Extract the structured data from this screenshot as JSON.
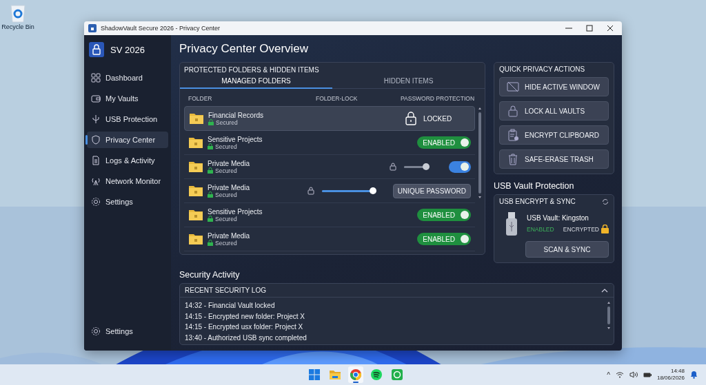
{
  "desktop": {
    "icons": [
      {
        "label": "Recycle Bin"
      }
    ]
  },
  "window": {
    "title": "ShadowVault Secure 2026 - Privacy Center"
  },
  "sidebar": {
    "brand": "SV 2026",
    "items": [
      {
        "label": "Dashboard",
        "selected": false
      },
      {
        "label": "My Vaults",
        "selected": false
      },
      {
        "label": "USB Protection",
        "selected": false
      },
      {
        "label": "Privacy Center",
        "selected": true
      },
      {
        "label": "Logs & Activity",
        "selected": false
      },
      {
        "label": "Network Monitor",
        "selected": false
      },
      {
        "label": "Settings",
        "selected": false
      }
    ],
    "footer_item": {
      "label": "Settings"
    }
  },
  "page_title": "Privacy Center Overview",
  "folders_panel": {
    "title": "PROTECTED FOLDERS & HIDDEN ITEMS",
    "tabs": [
      {
        "label": "MANAGED FOLDERS",
        "selected": true
      },
      {
        "label": "HIDDEN ITEMS",
        "selected": false
      }
    ],
    "columns": [
      "FOLDER",
      "FOLDER-LOCK",
      "PASSWORD PROTECTION"
    ],
    "rows": [
      {
        "name": "Financial Records",
        "status": "Secured",
        "selected": true,
        "protection": {
          "kind": "locked",
          "label": "LOCKED"
        }
      },
      {
        "name": "Sensitive Projects",
        "status": "Secured",
        "selected": false,
        "protection": {
          "kind": "labeled_toggle",
          "label": "ENABLED",
          "on": true
        }
      },
      {
        "name": "Private Media",
        "status": "Secured",
        "selected": false,
        "folder_lock": {
          "level": 0.9,
          "enabled": false
        },
        "protection": {
          "kind": "toggle",
          "on": true
        }
      },
      {
        "name": "Private Media",
        "status": "Secured",
        "selected": false,
        "folder_lock": {
          "level": 1,
          "enabled": true
        },
        "protection": {
          "kind": "button",
          "label": "UNIQUE PASSWORD"
        }
      },
      {
        "name": "Sensitive Projects",
        "status": "Secured",
        "selected": false,
        "protection": {
          "kind": "labeled_toggle",
          "label": "ENABLED",
          "on": true
        }
      },
      {
        "name": "Private Media",
        "status": "Secured",
        "selected": false,
        "protection": {
          "kind": "labeled_toggle",
          "label": "ENABLED",
          "on": true
        }
      }
    ]
  },
  "quick_actions": {
    "title": "QUICK PRIVACY ACTIONS",
    "buttons": [
      "HIDE ACTIVE WINDOW",
      "LOCK ALL VAULTS",
      "ENCRYPT CLIPBOARD",
      "SAFE-ERASE TRASH"
    ]
  },
  "usb": {
    "heading": "USB Vault Protection",
    "title": "USB ENCRYPT & SYNC",
    "device": "USB Vault: Kingston",
    "status": "ENABLED",
    "encryption": "ENCRYPTED",
    "button": "SCAN & SYNC"
  },
  "activity": {
    "heading": "Security Activity",
    "log_title": "RECENT SECURITY LOG",
    "expanded": true,
    "entries": [
      "14:32 - Financial Vault locked",
      "14:15 - Encrypted new folder: Project X",
      "14:15 - Encrypted usx folder: Project X",
      "13:40 - Authorized USB sync completed"
    ]
  },
  "taskbar": {
    "apps": [
      {
        "selected": false
      },
      {
        "selected": false
      },
      {
        "selected": true
      },
      {
        "selected": false
      },
      {
        "selected": false
      }
    ],
    "tray_chevron": "^",
    "time": "14:48",
    "date": "18/06/2026"
  }
}
